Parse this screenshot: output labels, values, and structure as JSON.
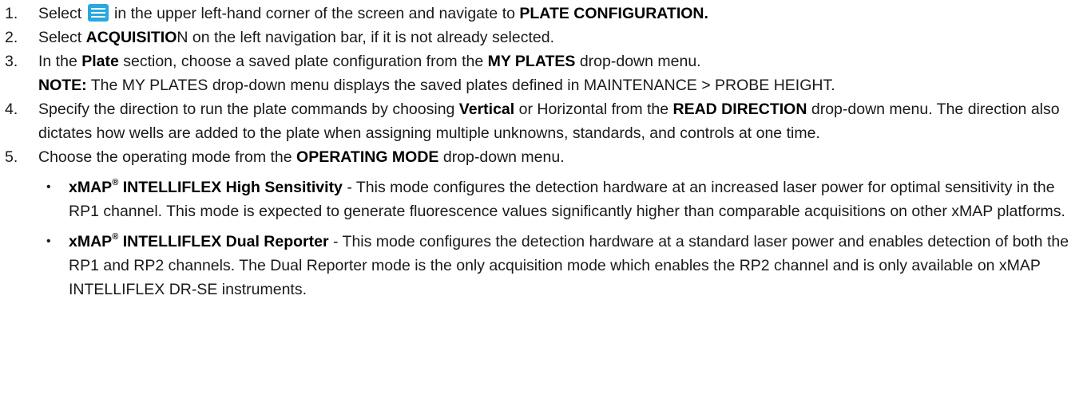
{
  "steps": [
    {
      "num": "1.",
      "pre": "Select ",
      "icon": "hamburger-menu-icon",
      "mid": " in the upper left-hand corner of the screen and navigate to ",
      "bold": "PLATE CONFIGURATION."
    },
    {
      "num": "2.",
      "pre": "Select ",
      "bold": "ACQUISITIO",
      "post": "N on the left navigation bar, if it is not already selected."
    },
    {
      "num": "3.",
      "pre": "In the ",
      "bold1": "Plate",
      "mid": " section, choose a saved plate configuration from the ",
      "bold2": "MY PLATES",
      "post": " drop-down menu.",
      "note_label": "NOTE:",
      "note_text": " The MY PLATES drop-down menu displays the saved plates defined in MAINTENANCE > PROBE HEIGHT."
    },
    {
      "num": "4.",
      "pre": "Specify the direction to run the plate commands by choosing ",
      "bold1": "Vertical",
      "mid": " or Horizontal from the ",
      "bold2": "READ DIRECTION",
      "post": " drop-down menu. The direction also dictates how wells are added to the plate when assigning multiple unknowns, standards, and controls at one time."
    },
    {
      "num": "5.",
      "pre": "Choose the operating mode from the ",
      "bold": "OPERATING MODE",
      "post": " drop-down menu.",
      "bullets": [
        {
          "mark": "•",
          "title_a": "xMAP",
          "reg": "®",
          "title_b": " INTELLIFLEX High Sensitivity",
          "text": " - This mode configures the detection hardware at an increased laser power for optimal sensitivity in the RP1 channel. This mode is expected to generate fluorescence values significantly higher than comparable acquisitions on other xMAP platforms."
        },
        {
          "mark": "•",
          "title_a": "xMAP",
          "reg": "®",
          "title_b": " INTELLIFLEX Dual Reporter",
          "text": " - This mode configures the detection hardware at a standard laser power and enables detection of both the RP1 and RP2 channels. The Dual Reporter mode is the only acquisition mode which enables the RP2 channel and is only available on xMAP INTELLIFLEX DR-SE instruments."
        }
      ]
    }
  ],
  "colors": {
    "menu_icon_bg": "#29a8e0",
    "text": "#1a1a1a"
  }
}
